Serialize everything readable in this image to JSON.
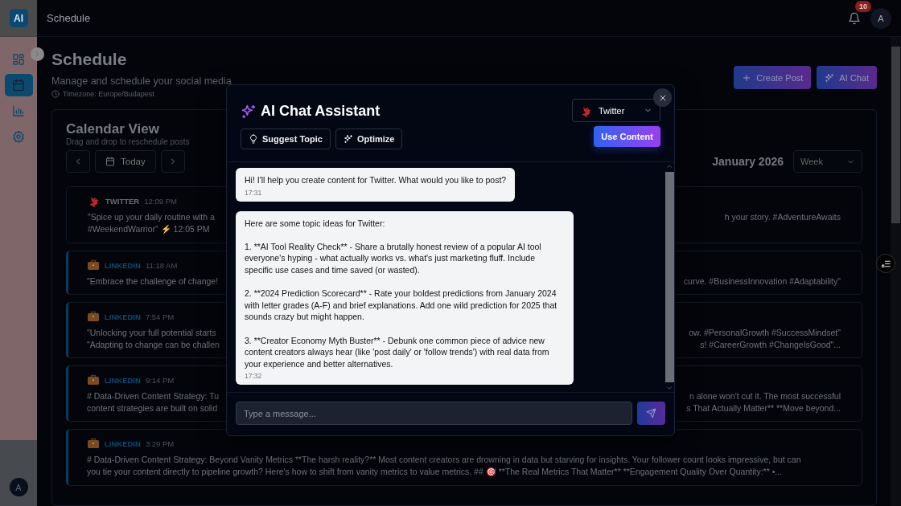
{
  "sidebar": {
    "logo": "AI",
    "items": [
      {
        "kind": "grid",
        "selected": false
      },
      {
        "kind": "calendar",
        "selected": true
      },
      {
        "kind": "chart",
        "selected": false
      },
      {
        "kind": "gear",
        "selected": false
      }
    ],
    "avatar": "A"
  },
  "header": {
    "title": "Schedule",
    "notification_count": "10",
    "avatar": "A"
  },
  "page": {
    "title": "Schedule",
    "subtitle": "Manage and schedule your social media",
    "timezone": "Timezone: Europe/Budapest",
    "buttons": [
      {
        "label": "Create Post",
        "kind": "create"
      },
      {
        "label": "AI Chat",
        "kind": "ai"
      }
    ]
  },
  "calendar": {
    "title": "Calendar View",
    "subtitle": "Drag and drop to reschedule posts",
    "today": "Today",
    "month": "January 2026",
    "view": "Week",
    "posts": [
      {
        "kind": "twitter",
        "label": "TWITTER",
        "time": "12:09 PM",
        "lines": [
          {
            "left": "\"Spice up your daily routine with a",
            "right": "h your story. #AdventureAwaits"
          },
          {
            "left": "#WeekendWarrior\" ⚡ 12:05 PM"
          }
        ]
      },
      {
        "kind": "linkedin",
        "label": "LINKEDIN",
        "time": "11:18 AM",
        "lines": [
          {
            "left": "\"Embrace the challenge of change!",
            "right": "curve. #BusinessInnovation #Adaptability\""
          }
        ]
      },
      {
        "kind": "linkedin",
        "label": "LINKEDIN",
        "time": "7:54 PM",
        "lines": [
          {
            "left": "\"Unlocking your full potential starts",
            "right": "ow. #PersonalGrowth #SuccessMindset\""
          },
          {
            "left": "\"Adapting to change can be challen",
            "right": "s! #CareerGrowth #ChangeIsGood\"..."
          }
        ]
      },
      {
        "kind": "linkedin",
        "label": "LINKEDIN",
        "time": "9:14 PM",
        "lines": [
          {
            "left": "# Data-Driven Content Strategy: Tu",
            "right": "n alone won't cut it. The most successful"
          },
          {
            "left": "content strategies are built on solid",
            "right": "s That Actually Matter** **Move beyond..."
          }
        ]
      },
      {
        "kind": "linkedin",
        "label": "LINKEDIN",
        "time": "3:29 PM",
        "lines": [
          {
            "left": "# Data-Driven Content Strategy: Beyond Vanity Metrics **The harsh reality?** Most content creators are drowning in data but starving for insights. Your follower count looks impressive, but can"
          },
          {
            "left": "you tie your content directly to pipeline growth? Here's how to shift from vanity metrics to value metrics. ## 🎯 **The Real Metrics That Matter** **Engagement Quality Over Quantity:** •..."
          }
        ]
      }
    ]
  },
  "chat": {
    "title": "AI Chat Assistant",
    "actions": [
      {
        "label": "Suggest Topic",
        "kind": "bulb"
      },
      {
        "label": "Optimize",
        "kind": "sparkle"
      }
    ],
    "platform": {
      "label": "Twitter",
      "kind": "twitter"
    },
    "use_button": "Use Content",
    "messages": [
      {
        "text": "Hi! I'll help you create content for Twitter. What would you like to post?",
        "time": "17:31"
      },
      {
        "text": "Here are some topic ideas for Twitter:\n\n1. **AI Tool Reality Check** - Share a brutally honest review of a popular AI tool everyone's hyping - what actually works vs. what's just marketing fluff. Include specific use cases and time saved (or wasted).\n\n2. **2024 Prediction Scorecard** - Rate your boldest predictions from January 2024 with letter grades (A-F) and brief explanations. Add one wild prediction for 2025 that sounds crazy but might happen.\n\n3. **Creator Economy Myth Buster** - Debunk one common piece of advice new content creators always hear (like 'post daily' or 'follow trends') with real data from your experience and better alternatives.",
        "time": "17:32"
      }
    ],
    "input": {
      "placeholder": "Type a message..."
    }
  }
}
